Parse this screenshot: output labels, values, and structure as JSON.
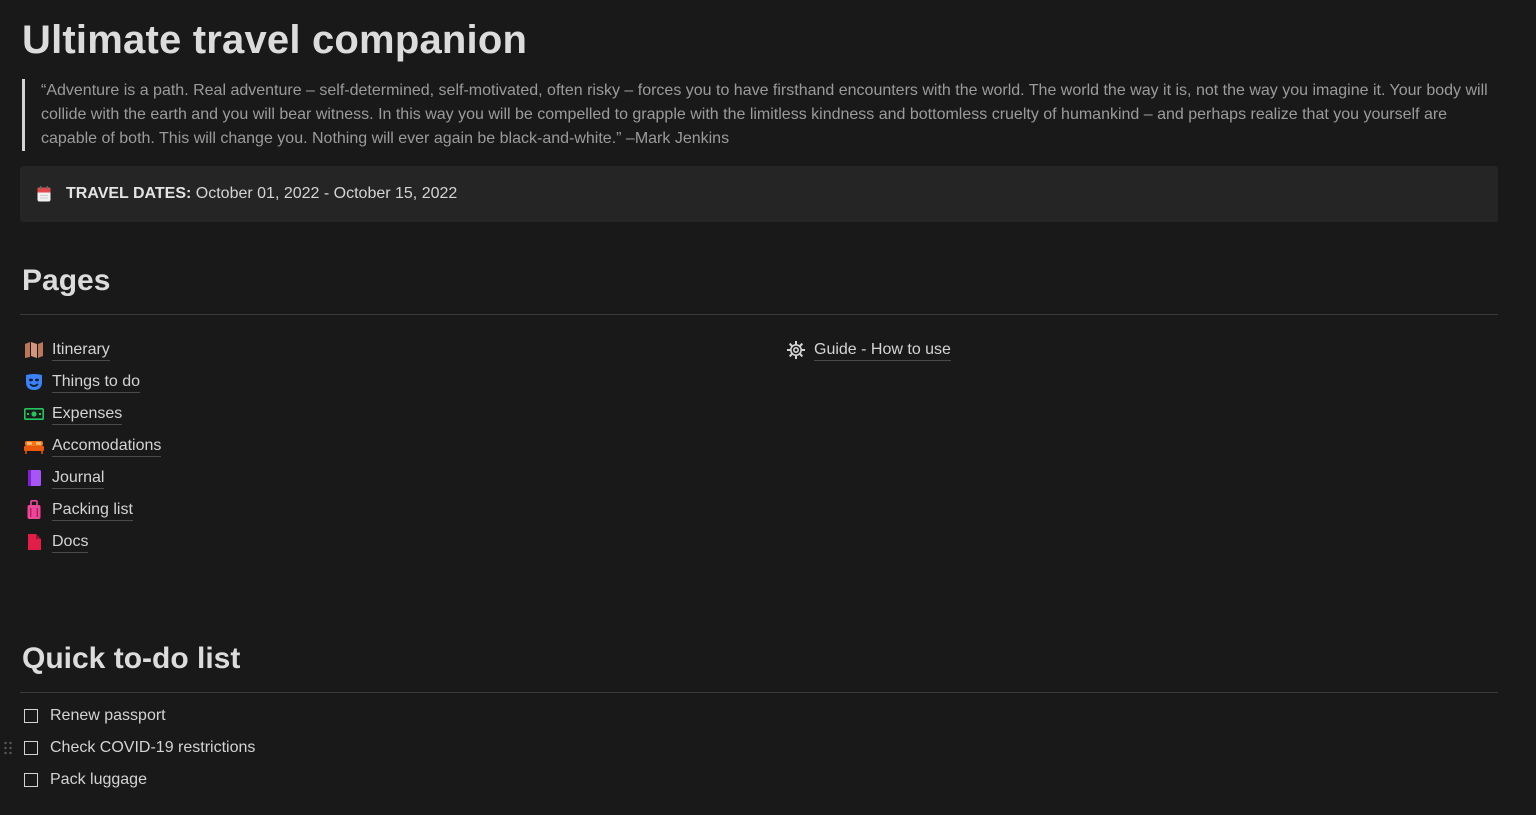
{
  "page": {
    "title": "Ultimate travel companion",
    "quote": "“Adventure is a path. Real adventure – self-determined, self-motivated, often risky – forces you to have firsthand encounters with the world. The world the way it is, not the way you imagine it. Your body will collide with the earth and you will bear witness. In this way you will be compelled to grapple with the limitless kindness and bottomless cruelty of humankind – and perhaps realize that you yourself are capable of both. This will change you. Nothing will ever again be black-and-white.” –Mark Jenkins"
  },
  "callout": {
    "icon": "calendar-icon",
    "label": "TRAVEL DATES:",
    "value": " October 01, 2022 - October 15, 2022"
  },
  "pages_section": {
    "heading": "Pages",
    "left_links": [
      {
        "label": "Itinerary",
        "icon": "map-icon",
        "color": "#c48a6a"
      },
      {
        "label": "Things to do",
        "icon": "performing-arts-icon",
        "color": "#3b82f6"
      },
      {
        "label": "Expenses",
        "icon": "money-icon",
        "color": "#22c55e"
      },
      {
        "label": "Accomodations",
        "icon": "bed-icon",
        "color": "#f97316"
      },
      {
        "label": "Journal",
        "icon": "notebook-icon",
        "color": "#a855f7"
      },
      {
        "label": "Packing list",
        "icon": "luggage-icon",
        "color": "#ec4899"
      },
      {
        "label": "Docs",
        "icon": "document-icon",
        "color": "#e11d48"
      }
    ],
    "right_links": [
      {
        "label": "Guide - How to use",
        "icon": "gear-icon",
        "color": "#d4d4d4"
      }
    ]
  },
  "todo_section": {
    "heading": "Quick to-do list",
    "items": [
      {
        "label": "Renew passport",
        "checked": false
      },
      {
        "label": "Check COVID-19 restrictions",
        "checked": false
      },
      {
        "label": "Pack luggage",
        "checked": false
      }
    ]
  },
  "colors": {
    "background": "#191919",
    "callout_bg": "#252525",
    "text": "#d4d4d4",
    "muted": "#9b9b9b"
  }
}
